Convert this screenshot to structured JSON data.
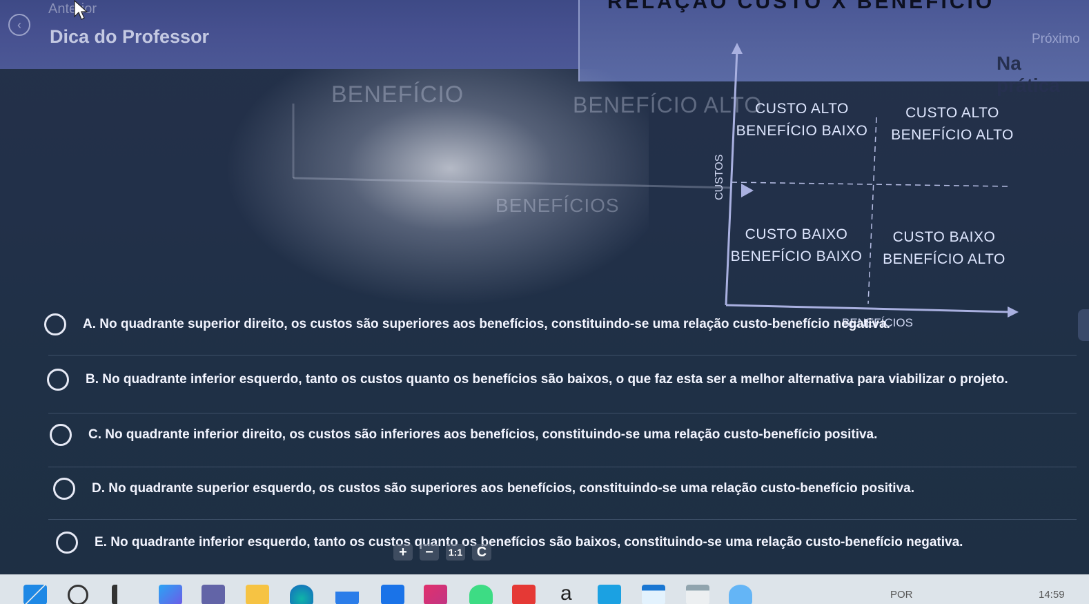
{
  "header": {
    "top_title": "RELAÇÃO CUSTO X BENEFÍCIO",
    "prev_label": "Anterior",
    "title": "Dica do Professor",
    "next_label": "Próximo",
    "section": "Na prática"
  },
  "diagram": {
    "faded_left": "BENEFÍCIO",
    "faded_top": "BENEFÍCIO ALTO",
    "faded_middle": "BENEFÍCIOS",
    "y_axis_label": "CUSTOS",
    "x_axis_label": "BENEFÍCIOS",
    "quadrants": {
      "top_left": [
        "CUSTO ALTO",
        "BENEFÍCIO BAIXO"
      ],
      "top_right": [
        "CUSTO ALTO",
        "BENEFÍCIO ALTO"
      ],
      "bottom_left": [
        "CUSTO BAIXO",
        "BENEFÍCIO BAIXO"
      ],
      "bottom_right": [
        "CUSTO BAIXO",
        "BENEFÍCIO ALTO"
      ]
    }
  },
  "options": [
    {
      "text": "A. No quadrante superior direito, os custos são superiores aos benefícios, constituindo-se uma relação custo-benefício negativa."
    },
    {
      "text": "B. No quadrante inferior esquerdo, tanto os custos quanto os benefícios são baixos, o que faz esta ser a melhor alternativa para viabilizar o projeto."
    },
    {
      "text": "C. No quadrante inferior direito, os custos são inferiores aos benefícios, constituindo-se uma relação custo-benefício positiva."
    },
    {
      "text": "D. No quadrante superior esquerdo, os custos são superiores aos benefícios, constituindo-se uma relação custo-benefício positiva."
    },
    {
      "text": "E. No quadrante inferior esquerdo, tanto os custos quanto os benefícios são baixos, constituindo-se uma relação custo-benefício negativa."
    }
  ],
  "zoom_tools": {
    "plus": "+",
    "minus": "−",
    "reset": "1:1",
    "rotate": "C"
  },
  "taskbar": {
    "language": "POR",
    "time": "14:59",
    "amazon_glyph": "a",
    "colors": {
      "windows": "#1e88e5",
      "accent": "#3f51b5"
    }
  }
}
